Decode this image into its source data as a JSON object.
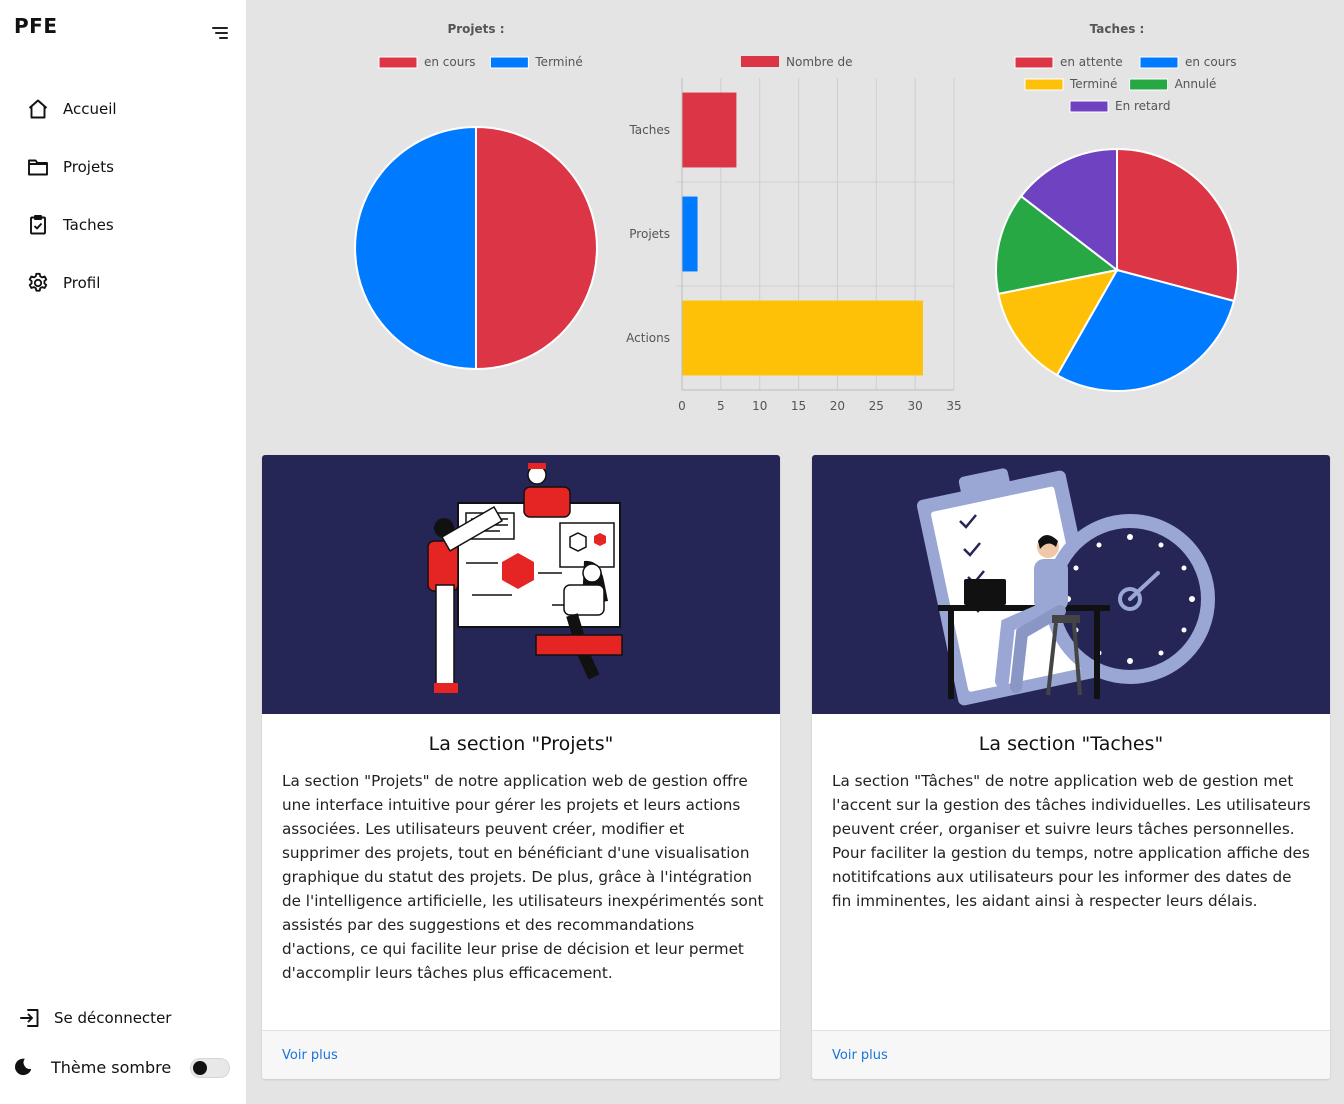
{
  "brand": "PFE",
  "nav": [
    {
      "label": "Accueil",
      "icon": "home-icon"
    },
    {
      "label": "Projets",
      "icon": "folder-icon"
    },
    {
      "label": "Taches",
      "icon": "clipboard-check-icon"
    },
    {
      "label": "Profil",
      "icon": "gear-icon"
    }
  ],
  "logout_label": "Se déconnecter",
  "theme_label": "Thème sombre",
  "colors": {
    "red": "#dc3545",
    "blue": "#007bff",
    "yellow": "#ffc107",
    "green": "#28a745",
    "purple": "#6f42c1",
    "card_image_bg": "#252656"
  },
  "chart_data": [
    {
      "type": "pie",
      "title": "Projets :",
      "labels": [
        "en cours",
        "Terminé"
      ],
      "values": [
        1,
        1
      ],
      "colors": [
        "#dc3545",
        "#007bff"
      ],
      "legend": "top"
    },
    {
      "type": "bar",
      "orientation": "horizontal",
      "title": "",
      "legend_label": "Nombre de",
      "categories": [
        "Taches",
        "Projets",
        "Actions"
      ],
      "values": [
        7,
        2,
        31
      ],
      "colors": [
        "#dc3545",
        "#007bff",
        "#ffc107"
      ],
      "xlim": [
        0,
        35
      ],
      "xticks": [
        "0",
        "5",
        "10",
        "15",
        "20",
        "25",
        "30",
        "35"
      ],
      "grid": true,
      "legend": "top"
    },
    {
      "type": "pie",
      "title": "Taches :",
      "labels": [
        "en attente",
        "en cours",
        "Terminé",
        "Annulé",
        "En retard"
      ],
      "values": [
        30,
        30,
        14,
        14,
        15
      ],
      "colors": [
        "#dc3545",
        "#007bff",
        "#ffc107",
        "#28a745",
        "#6f42c1"
      ],
      "legend": "top"
    }
  ],
  "cards": [
    {
      "title": "La section \"Projets\"",
      "text": "La section \"Projets\" de notre application web de gestion offre une interface intuitive pour gérer les projets et leurs actions associées. Les utilisateurs peuvent créer, modifier et supprimer des projets, tout en bénéficiant d'une visualisation graphique du statut des projets. De plus, grâce à l'intégration de l'intelligence artificielle, les utilisateurs inexpérimentés sont assistés par des suggestions et des recommandations d'actions, ce qui facilite leur prise de décision et leur permet d'accomplir leurs tâches plus efficacement.",
      "link": "Voir plus"
    },
    {
      "title": "La section \"Taches\"",
      "text": "La section \"Tâches\" de notre application web de gestion met l'accent sur la gestion des tâches individuelles. Les utilisateurs peuvent créer, organiser et suivre leurs tâches personnelles. Pour faciliter la gestion du temps, notre application affiche des notitifcations aux utilisateurs pour les informer des dates de fin imminentes, les aidant ainsi à respecter leurs délais.",
      "link": "Voir plus"
    }
  ]
}
